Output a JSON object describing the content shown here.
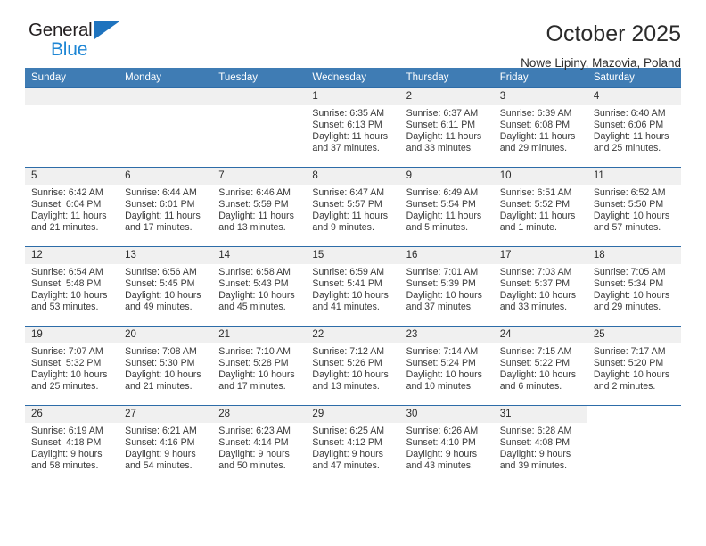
{
  "logo": {
    "word_top": "General",
    "word_bottom": "Blue",
    "triangle_color": "#1e73be",
    "blue_color": "#1e86d4"
  },
  "header": {
    "title": "October 2025",
    "subtitle": "Nowe Lipiny, Mazovia, Poland"
  },
  "theme": {
    "header_bg": "#3f7cb4",
    "row_border": "#2d6ca8",
    "daynum_bg": "#f0f0f0"
  },
  "weekdays": [
    "Sunday",
    "Monday",
    "Tuesday",
    "Wednesday",
    "Thursday",
    "Friday",
    "Saturday"
  ],
  "labels": {
    "sunrise": "Sunrise:",
    "sunset": "Sunset:",
    "daylight": "Daylight:"
  },
  "weeks": [
    [
      {
        "day": "",
        "empty": true
      },
      {
        "day": "",
        "empty": true
      },
      {
        "day": "",
        "empty": true
      },
      {
        "day": "1",
        "sunrise": "Sunrise: 6:35 AM",
        "sunset": "Sunset: 6:13 PM",
        "daylight1": "Daylight: 11 hours",
        "daylight2": "and 37 minutes."
      },
      {
        "day": "2",
        "sunrise": "Sunrise: 6:37 AM",
        "sunset": "Sunset: 6:11 PM",
        "daylight1": "Daylight: 11 hours",
        "daylight2": "and 33 minutes."
      },
      {
        "day": "3",
        "sunrise": "Sunrise: 6:39 AM",
        "sunset": "Sunset: 6:08 PM",
        "daylight1": "Daylight: 11 hours",
        "daylight2": "and 29 minutes."
      },
      {
        "day": "4",
        "sunrise": "Sunrise: 6:40 AM",
        "sunset": "Sunset: 6:06 PM",
        "daylight1": "Daylight: 11 hours",
        "daylight2": "and 25 minutes."
      }
    ],
    [
      {
        "day": "5",
        "sunrise": "Sunrise: 6:42 AM",
        "sunset": "Sunset: 6:04 PM",
        "daylight1": "Daylight: 11 hours",
        "daylight2": "and 21 minutes."
      },
      {
        "day": "6",
        "sunrise": "Sunrise: 6:44 AM",
        "sunset": "Sunset: 6:01 PM",
        "daylight1": "Daylight: 11 hours",
        "daylight2": "and 17 minutes."
      },
      {
        "day": "7",
        "sunrise": "Sunrise: 6:46 AM",
        "sunset": "Sunset: 5:59 PM",
        "daylight1": "Daylight: 11 hours",
        "daylight2": "and 13 minutes."
      },
      {
        "day": "8",
        "sunrise": "Sunrise: 6:47 AM",
        "sunset": "Sunset: 5:57 PM",
        "daylight1": "Daylight: 11 hours",
        "daylight2": "and 9 minutes."
      },
      {
        "day": "9",
        "sunrise": "Sunrise: 6:49 AM",
        "sunset": "Sunset: 5:54 PM",
        "daylight1": "Daylight: 11 hours",
        "daylight2": "and 5 minutes."
      },
      {
        "day": "10",
        "sunrise": "Sunrise: 6:51 AM",
        "sunset": "Sunset: 5:52 PM",
        "daylight1": "Daylight: 11 hours",
        "daylight2": "and 1 minute."
      },
      {
        "day": "11",
        "sunrise": "Sunrise: 6:52 AM",
        "sunset": "Sunset: 5:50 PM",
        "daylight1": "Daylight: 10 hours",
        "daylight2": "and 57 minutes."
      }
    ],
    [
      {
        "day": "12",
        "sunrise": "Sunrise: 6:54 AM",
        "sunset": "Sunset: 5:48 PM",
        "daylight1": "Daylight: 10 hours",
        "daylight2": "and 53 minutes."
      },
      {
        "day": "13",
        "sunrise": "Sunrise: 6:56 AM",
        "sunset": "Sunset: 5:45 PM",
        "daylight1": "Daylight: 10 hours",
        "daylight2": "and 49 minutes."
      },
      {
        "day": "14",
        "sunrise": "Sunrise: 6:58 AM",
        "sunset": "Sunset: 5:43 PM",
        "daylight1": "Daylight: 10 hours",
        "daylight2": "and 45 minutes."
      },
      {
        "day": "15",
        "sunrise": "Sunrise: 6:59 AM",
        "sunset": "Sunset: 5:41 PM",
        "daylight1": "Daylight: 10 hours",
        "daylight2": "and 41 minutes."
      },
      {
        "day": "16",
        "sunrise": "Sunrise: 7:01 AM",
        "sunset": "Sunset: 5:39 PM",
        "daylight1": "Daylight: 10 hours",
        "daylight2": "and 37 minutes."
      },
      {
        "day": "17",
        "sunrise": "Sunrise: 7:03 AM",
        "sunset": "Sunset: 5:37 PM",
        "daylight1": "Daylight: 10 hours",
        "daylight2": "and 33 minutes."
      },
      {
        "day": "18",
        "sunrise": "Sunrise: 7:05 AM",
        "sunset": "Sunset: 5:34 PM",
        "daylight1": "Daylight: 10 hours",
        "daylight2": "and 29 minutes."
      }
    ],
    [
      {
        "day": "19",
        "sunrise": "Sunrise: 7:07 AM",
        "sunset": "Sunset: 5:32 PM",
        "daylight1": "Daylight: 10 hours",
        "daylight2": "and 25 minutes."
      },
      {
        "day": "20",
        "sunrise": "Sunrise: 7:08 AM",
        "sunset": "Sunset: 5:30 PM",
        "daylight1": "Daylight: 10 hours",
        "daylight2": "and 21 minutes."
      },
      {
        "day": "21",
        "sunrise": "Sunrise: 7:10 AM",
        "sunset": "Sunset: 5:28 PM",
        "daylight1": "Daylight: 10 hours",
        "daylight2": "and 17 minutes."
      },
      {
        "day": "22",
        "sunrise": "Sunrise: 7:12 AM",
        "sunset": "Sunset: 5:26 PM",
        "daylight1": "Daylight: 10 hours",
        "daylight2": "and 13 minutes."
      },
      {
        "day": "23",
        "sunrise": "Sunrise: 7:14 AM",
        "sunset": "Sunset: 5:24 PM",
        "daylight1": "Daylight: 10 hours",
        "daylight2": "and 10 minutes."
      },
      {
        "day": "24",
        "sunrise": "Sunrise: 7:15 AM",
        "sunset": "Sunset: 5:22 PM",
        "daylight1": "Daylight: 10 hours",
        "daylight2": "and 6 minutes."
      },
      {
        "day": "25",
        "sunrise": "Sunrise: 7:17 AM",
        "sunset": "Sunset: 5:20 PM",
        "daylight1": "Daylight: 10 hours",
        "daylight2": "and 2 minutes."
      }
    ],
    [
      {
        "day": "26",
        "sunrise": "Sunrise: 6:19 AM",
        "sunset": "Sunset: 4:18 PM",
        "daylight1": "Daylight: 9 hours",
        "daylight2": "and 58 minutes."
      },
      {
        "day": "27",
        "sunrise": "Sunrise: 6:21 AM",
        "sunset": "Sunset: 4:16 PM",
        "daylight1": "Daylight: 9 hours",
        "daylight2": "and 54 minutes."
      },
      {
        "day": "28",
        "sunrise": "Sunrise: 6:23 AM",
        "sunset": "Sunset: 4:14 PM",
        "daylight1": "Daylight: 9 hours",
        "daylight2": "and 50 minutes."
      },
      {
        "day": "29",
        "sunrise": "Sunrise: 6:25 AM",
        "sunset": "Sunset: 4:12 PM",
        "daylight1": "Daylight: 9 hours",
        "daylight2": "and 47 minutes."
      },
      {
        "day": "30",
        "sunrise": "Sunrise: 6:26 AM",
        "sunset": "Sunset: 4:10 PM",
        "daylight1": "Daylight: 9 hours",
        "daylight2": "and 43 minutes."
      },
      {
        "day": "31",
        "sunrise": "Sunrise: 6:28 AM",
        "sunset": "Sunset: 4:08 PM",
        "daylight1": "Daylight: 9 hours",
        "daylight2": "and 39 minutes."
      },
      {
        "day": "",
        "blank": true
      }
    ]
  ]
}
